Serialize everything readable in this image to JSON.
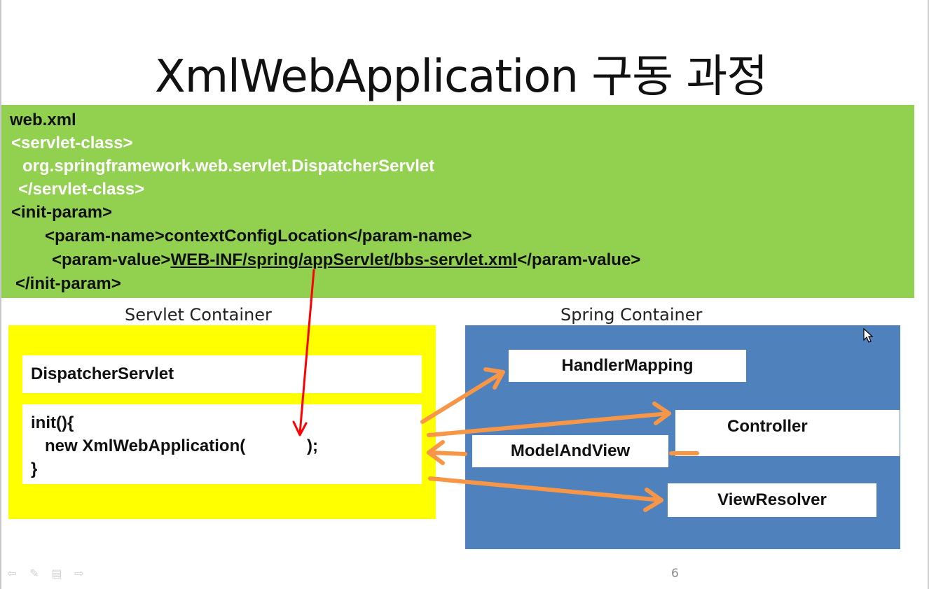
{
  "title": "XmlWebApplication 구동 과정",
  "web_xml": {
    "heading": "web.xml",
    "servlet_class_open": "<servlet-class>",
    "servlet_class_value": "org.springframework.web.servlet.DispatcherServlet",
    "servlet_class_close": "</servlet-class>",
    "init_param_open": "<init-param>",
    "param_name_open": "<param-name>",
    "param_name_value": "contextConfigLocation",
    "param_name_close": "</param-name>",
    "param_value_open": "<param-value>",
    "param_value_value": "WEB-INF/spring/appServlet/bbs-servlet.xml",
    "param_value_close": "</param-value>",
    "init_param_close": "</init-param>"
  },
  "servlet_container": {
    "label": "Servlet Container",
    "dispatcher_label": "DispatcherServlet",
    "code_line1": "init(){",
    "code_line2": "new XmlWebApplication(",
    "code_line2_end": ");",
    "code_line3": "}"
  },
  "spring_container": {
    "label": "Spring Container",
    "handler_mapping": "HandlerMapping",
    "controller": "Controller",
    "model_and_view": "ModelAndView",
    "view_resolver": "ViewResolver"
  },
  "page_number": "6",
  "colors": {
    "code_box": "#92d050",
    "servlet_container": "#ffff00",
    "spring_container": "#4f81bd",
    "orange_arrow": "#f79646",
    "red_arrow": "#ff0000"
  },
  "icons": {
    "nav_prev": "arrow-left-icon",
    "nav_pen": "pen-icon",
    "nav_menu": "menu-icon",
    "nav_next": "arrow-right-icon",
    "cursor": "mouse-cursor-icon"
  }
}
